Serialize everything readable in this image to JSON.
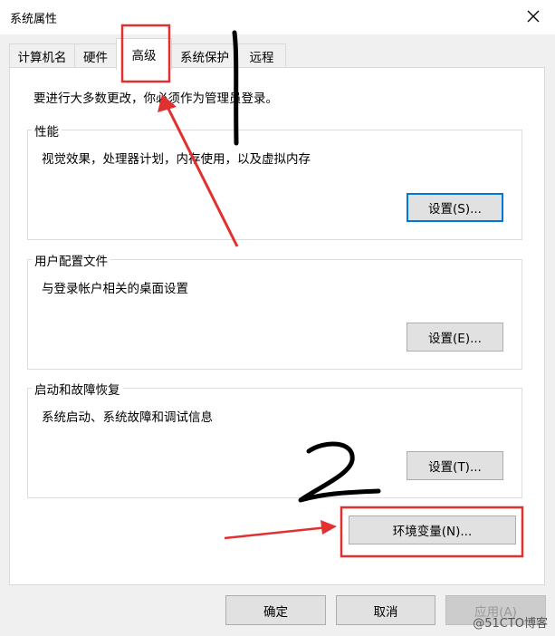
{
  "window": {
    "title": "系统属性"
  },
  "tabs": [
    {
      "label": "计算机名"
    },
    {
      "label": "硬件"
    },
    {
      "label": "高级"
    },
    {
      "label": "系统保护"
    },
    {
      "label": "远程"
    }
  ],
  "intro": "要进行大多数更改，你必须作为管理员登录。",
  "groups": {
    "performance": {
      "title": "性能",
      "desc": "视觉效果，处理器计划，内存使用，以及虚拟内存",
      "button": "设置(S)..."
    },
    "profiles": {
      "title": "用户配置文件",
      "desc": "与登录帐户相关的桌面设置",
      "button": "设置(E)..."
    },
    "startup": {
      "title": "启动和故障恢复",
      "desc": "系统启动、系统故障和调试信息",
      "button": "设置(T)..."
    }
  },
  "env_button": "环境变量(N)...",
  "footer": {
    "ok": "确定",
    "cancel": "取消",
    "apply": "应用(A)"
  },
  "annotation_color": "#e03030",
  "watermark": "@51CTO博客"
}
